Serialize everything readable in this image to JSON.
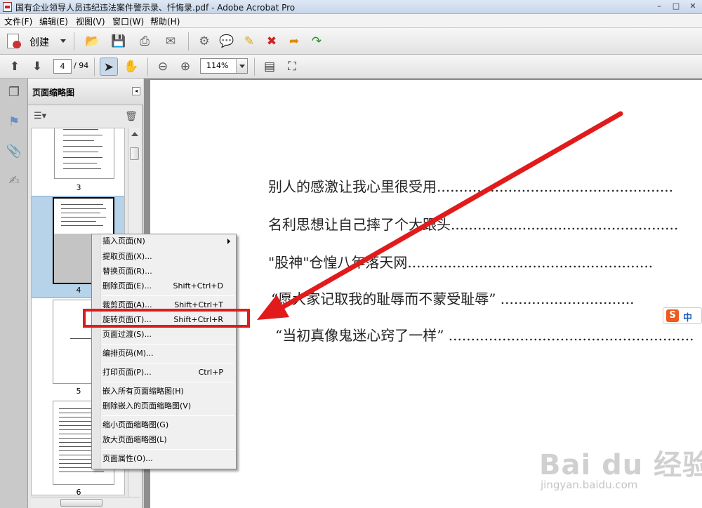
{
  "window": {
    "title": "国有企业领导人员违纪违法案件警示录、忏悔录.pdf - Adobe Acrobat Pro",
    "minimize": "–",
    "maximize": "□",
    "close": "✕"
  },
  "menubar": {
    "items": [
      "文件(F)",
      "编辑(E)",
      "视图(V)",
      "窗口(W)",
      "帮助(H)"
    ]
  },
  "toolbar": {
    "create_label": "创建",
    "icons": [
      "open-folder-icon",
      "save-icon",
      "print-icon",
      "email-icon",
      "settings-gear-icon",
      "comment-bubble-icon",
      "sticky-note-icon",
      "remove-document-icon",
      "export-document-icon",
      "share-document-icon"
    ]
  },
  "navbar": {
    "current_page": "4",
    "total_pages": "/ 94",
    "zoom": "114%"
  },
  "panel": {
    "title": "页面缩略图",
    "collapse": "◂",
    "thumbnails": [
      {
        "label": "3"
      },
      {
        "label": "4"
      },
      {
        "label": "5"
      },
      {
        "label": "6"
      }
    ]
  },
  "context_menu": {
    "items": [
      {
        "label": "插入页面(N)",
        "shortcut": "",
        "submenu": true
      },
      {
        "label": "提取页面(X)...",
        "shortcut": ""
      },
      {
        "label": "替换页面(R)...",
        "shortcut": ""
      },
      {
        "label": "删除页面(E)...",
        "shortcut": "Shift+Ctrl+D"
      },
      {
        "label": "裁剪页面(A)...",
        "shortcut": "Shift+Ctrl+T"
      },
      {
        "label": "旋转页面(T)...",
        "shortcut": "Shift+Ctrl+R"
      },
      {
        "label": "页面过渡(S)...",
        "shortcut": ""
      },
      {
        "label": "编排页码(M)...",
        "shortcut": ""
      },
      {
        "label": "打印页面(P)...",
        "shortcut": "Ctrl+P"
      },
      {
        "label": "嵌入所有页面缩略图(H)",
        "shortcut": ""
      },
      {
        "label": "删除嵌入的页面缩略图(V)",
        "shortcut": ""
      },
      {
        "label": "缩小页面缩略图(G)",
        "shortcut": ""
      },
      {
        "label": "放大页面缩略图(L)",
        "shortcut": ""
      },
      {
        "label": "页面属性(O)...",
        "shortcut": ""
      }
    ]
  },
  "document": {
    "lines": [
      "别人的感激让我心里很受用.....................................................",
      "名利思想让自己摔了个大跟头...................................................",
      "\"股神\"仓惶八年落天网.......................................................",
      "“愿大家记取我的耻辱而不蒙受耻辱” ..............................",
      "“当初真像鬼迷心窍了一样” .......................................................",
      ".........................................................................",
      "........................................................................."
    ]
  },
  "ime": {
    "logo": "S",
    "mode": "中"
  },
  "watermark": {
    "brand": "Bai du 经验",
    "url": "jingyan.baidu.com"
  },
  "colors": {
    "annotation_red": "#e11b1b",
    "selection_blue": "#b6d3ea"
  }
}
